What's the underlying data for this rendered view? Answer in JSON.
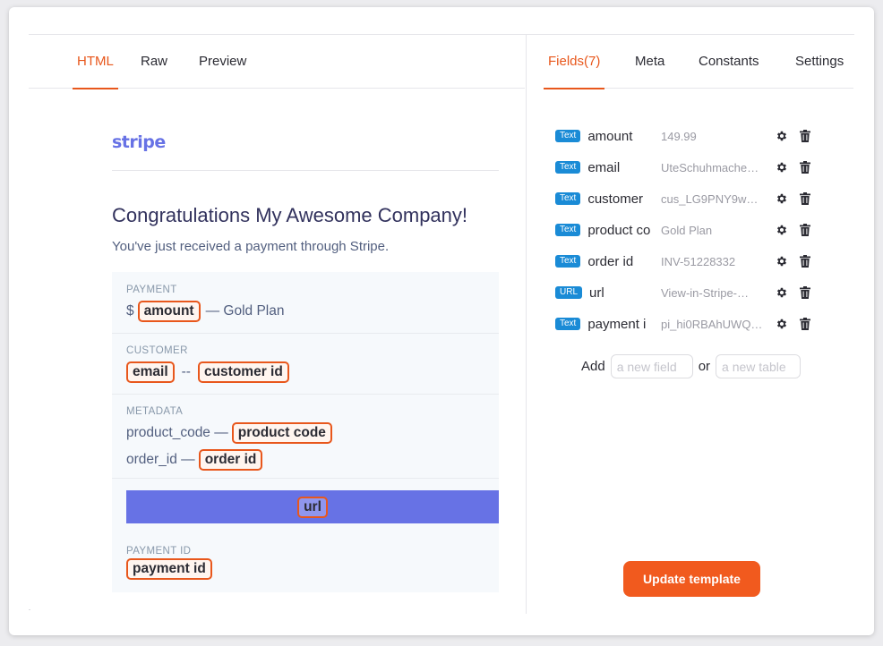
{
  "left_tabs": [
    {
      "label": "HTML",
      "active": true
    },
    {
      "label": "Raw",
      "active": false
    },
    {
      "label": "Preview",
      "active": false
    }
  ],
  "right_tabs": [
    {
      "label": "Fields(7)",
      "active": true
    },
    {
      "label": "Meta",
      "active": false
    },
    {
      "label": "Constants",
      "active": false
    },
    {
      "label": "Settings",
      "active": false
    }
  ],
  "email": {
    "logo": "stripe",
    "heading": "Congratulations My Awesome Company!",
    "subheading": "You've just received a payment through Stripe.",
    "payment": {
      "label": "PAYMENT",
      "currency": "$",
      "amount_chip": "amount",
      "suffix": "— Gold Plan"
    },
    "customer": {
      "label": "CUSTOMER",
      "email_chip": "email",
      "separator": "--",
      "customer_chip": "customer id"
    },
    "metadata": {
      "label": "METADATA",
      "product_prefix": "product_code —",
      "product_chip": "product code",
      "order_prefix": "order_id —",
      "order_chip": "order id"
    },
    "button_chip": "url",
    "payment_id": {
      "label": "PAYMENT ID",
      "chip": "payment id"
    }
  },
  "fields": [
    {
      "type": "Text",
      "name": "amount",
      "value": "149.99"
    },
    {
      "type": "Text",
      "name": "email",
      "value": "UteSchuhmache…"
    },
    {
      "type": "Text",
      "name": "customer",
      "value": "cus_LG9PNY9w…"
    },
    {
      "type": "Text",
      "name": "product co",
      "value": "Gold Plan"
    },
    {
      "type": "Text",
      "name": "order id",
      "value": "INV-51228332"
    },
    {
      "type": "URL",
      "name": "url",
      "value": "View-in-Stripe-…"
    },
    {
      "type": "Text",
      "name": "payment i",
      "value": "pi_hi0RBAhUWQ…"
    }
  ],
  "add": {
    "label": "Add",
    "field_placeholder": "a new field",
    "or": "or",
    "table_placeholder": "a new table"
  },
  "update_button": "Update template",
  "colors": {
    "accent": "#e8571c",
    "stripe": "#6772e5",
    "badge": "#1a8bd6",
    "update": "#f15a1e"
  }
}
